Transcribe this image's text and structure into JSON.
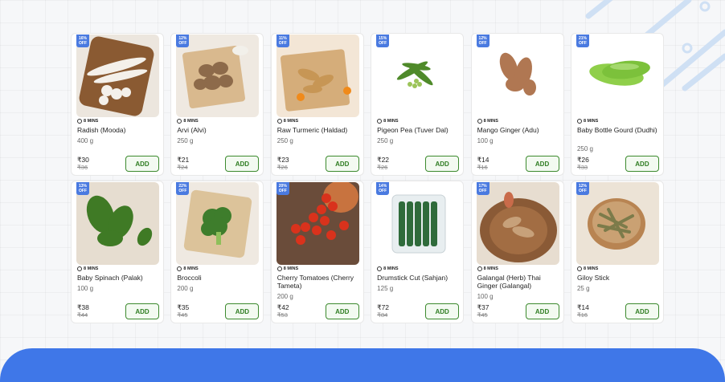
{
  "theme": {
    "accent": "#3f77e8",
    "add_green": "#3c8a2e",
    "badge_blue": "#4a7ae0"
  },
  "off_word": "OFF",
  "delivery_icon": "timer-icon",
  "add_label": "ADD",
  "products": [
    {
      "name": "Radish (Mooda)",
      "weight": "400 g",
      "price": "₹30",
      "mrp": "₹36",
      "discount": "16%",
      "eta": "8 MINS"
    },
    {
      "name": "Arvi (Alvi)",
      "weight": "250 g",
      "price": "₹21",
      "mrp": "₹24",
      "discount": "12%",
      "eta": "8 MINS"
    },
    {
      "name": "Raw Turmeric (Haldad)",
      "weight": "250 g",
      "price": "₹23",
      "mrp": "₹26",
      "discount": "11%",
      "eta": "8 MINS"
    },
    {
      "name": "Pigeon Pea (Tuver Dal)",
      "weight": "250 g",
      "price": "₹22",
      "mrp": "₹26",
      "discount": "15%",
      "eta": "8 MINS"
    },
    {
      "name": "Mango Ginger (Adu)",
      "weight": "100 g",
      "price": "₹14",
      "mrp": "₹16",
      "discount": "12%",
      "eta": "8 MINS"
    },
    {
      "name": "Baby Bottle Gourd (Dudhi)",
      "weight": "250 g",
      "price": "₹26",
      "mrp": "₹33",
      "discount": "21%",
      "eta": "8 MINS"
    },
    {
      "name": "Baby Spinach (Palak)",
      "weight": "100 g",
      "price": "₹38",
      "mrp": "₹44",
      "discount": "13%",
      "eta": "8 MINS"
    },
    {
      "name": "Broccoli",
      "weight": "200 g",
      "price": "₹35",
      "mrp": "₹45",
      "discount": "22%",
      "eta": "8 MINS"
    },
    {
      "name": "Cherry Tomatoes (Cherry Tameta)",
      "weight": "200 g",
      "price": "₹42",
      "mrp": "₹53",
      "discount": "20%",
      "eta": "8 MINS"
    },
    {
      "name": "Drumstick Cut (Sahjan)",
      "weight": "125 g",
      "price": "₹72",
      "mrp": "₹84",
      "discount": "14%",
      "eta": "8 MINS"
    },
    {
      "name": "Galangal (Herb) Thai Ginger (Galangal)",
      "weight": "100 g",
      "price": "₹37",
      "mrp": "₹45",
      "discount": "17%",
      "eta": "8 MINS"
    },
    {
      "name": "Giloy Stick",
      "weight": "25 g",
      "price": "₹14",
      "mrp": "₹16",
      "discount": "12%",
      "eta": "8 MINS"
    }
  ]
}
